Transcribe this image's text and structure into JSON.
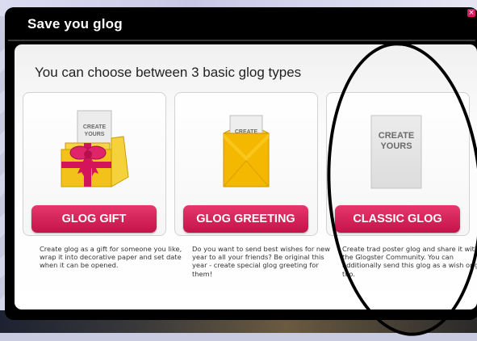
{
  "modal": {
    "title": "Save you glog",
    "close_glyph": "×",
    "heading": "You can choose between 3 basic glog types"
  },
  "cards": [
    {
      "id": "gift",
      "thumbnail_text_line1": "CREATE",
      "thumbnail_text_line2": "YOURS",
      "button_label": "GLOG GIFT",
      "description": "Create glog as a gift for someone you like, wrap it into decorative paper and set date when it can be opened."
    },
    {
      "id": "greeting",
      "thumbnail_text_line1": "CREATE",
      "button_label": "GLOG GREETING",
      "description": "Do you want to send best wishes for new year to all your friends? Be original this year - create special glog greeting for them!"
    },
    {
      "id": "classic",
      "thumbnail_text_line1": "CREATE",
      "thumbnail_text_line2": "YOURS",
      "button_label": "CLASSIC GLOG",
      "description": "Create trad poster glog and share it with the Glogster Community. You can additionally send this glog as a wish or gift too."
    }
  ],
  "colors": {
    "button": "#d81b60",
    "modal_background": "#000000",
    "panel_background": "#ffffff",
    "gift_box": "#f2c21a",
    "ribbon": "#d4145a",
    "envelope": "#f5b800"
  }
}
